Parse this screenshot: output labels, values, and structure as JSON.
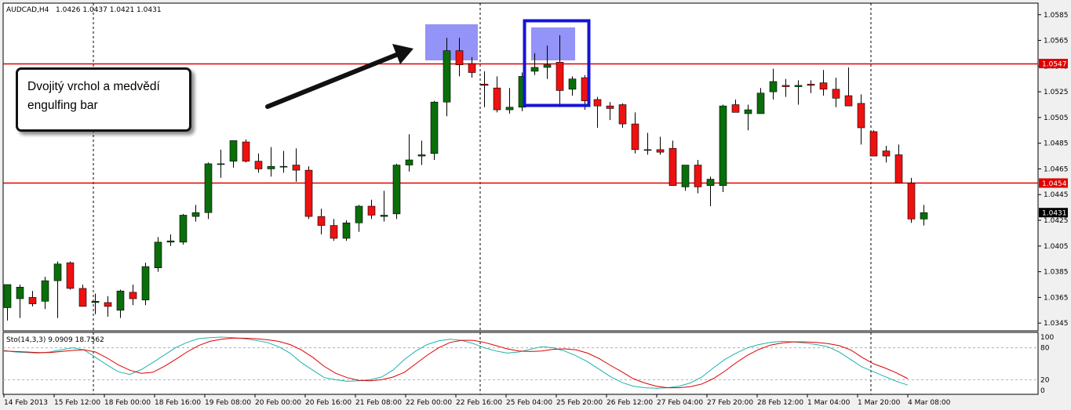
{
  "chart_header": {
    "symbol_timeframe": "AUDCAD,H4",
    "ohlc": "1.0426 1.0437 1.0421 1.0431"
  },
  "annotation": {
    "line1": "Dvojitý vrchol a medvědí",
    "line2": "engulfing bar"
  },
  "indicator": {
    "label": "Sto(14,3,3) 9.0909 18.7562",
    "levels": [
      "100",
      "80",
      "20",
      "0"
    ]
  },
  "colors": {
    "bull_body": "#0a6e0a",
    "bear_body": "#ee1111",
    "wick": "#000000",
    "hline": "#e00000",
    "highlight": "#6f6ff5",
    "box_border": "#1414d8",
    "stoch_main": "#20b2aa",
    "stoch_signal": "#e00000",
    "price_tag_bg": "#e00000",
    "last_price_bg": "#000000"
  },
  "chart_data": {
    "type": "candlestick",
    "y_axis_ticks": [
      "1.0585",
      "1.0565",
      "1.0545",
      "1.0525",
      "1.0505",
      "1.0485",
      "1.0465",
      "1.0445",
      "1.0425",
      "1.0405",
      "1.0385",
      "1.0365",
      "1.0345"
    ],
    "ylim": [
      1.0339,
      1.0594
    ],
    "horizontal_lines": [
      {
        "label": "1.0547",
        "value": 1.0547
      },
      {
        "label": "1.0454",
        "value": 1.0454
      }
    ],
    "last_price": {
      "label": "1.0431",
      "value": 1.0431
    },
    "x_axis_labels": [
      "14 Feb 2013",
      "15 Feb 12:00",
      "18 Feb 00:00",
      "18 Feb 16:00",
      "19 Feb 08:00",
      "20 Feb 00:00",
      "20 Feb 16:00",
      "21 Feb 08:00",
      "22 Feb 00:00",
      "22 Feb 16:00",
      "25 Feb 04:00",
      "25 Feb 20:00",
      "26 Feb 12:00",
      "27 Feb 04:00",
      "27 Feb 20:00",
      "28 Feb 12:00",
      "1 Mar 04:00",
      "1 Mar 20:00",
      "4 Mar 08:00"
    ],
    "candles": [
      [
        1.0357,
        1.0375,
        1.0347,
        1.0375
      ],
      [
        1.0364,
        1.0375,
        1.0349,
        1.0373
      ],
      [
        1.0365,
        1.037,
        1.0358,
        1.036
      ],
      [
        1.0362,
        1.0381,
        1.0356,
        1.0378
      ],
      [
        1.0378,
        1.0393,
        1.0349,
        1.0391
      ],
      [
        1.0392,
        1.0393,
        1.0371,
        1.0372
      ],
      [
        1.0372,
        1.0375,
        1.0358,
        1.0358
      ],
      [
        1.0361,
        1.0368,
        1.0352,
        1.0362
      ],
      [
        1.0361,
        1.0366,
        1.035,
        1.0358
      ],
      [
        1.0355,
        1.0371,
        1.0349,
        1.037
      ],
      [
        1.0369,
        1.0375,
        1.0359,
        1.0364
      ],
      [
        1.0363,
        1.0392,
        1.0359,
        1.0389
      ],
      [
        1.0388,
        1.0412,
        1.0385,
        1.0408
      ],
      [
        1.0408,
        1.0414,
        1.0405,
        1.0409
      ],
      [
        1.0408,
        1.043,
        1.0406,
        1.0429
      ],
      [
        1.0428,
        1.0437,
        1.0424,
        1.0431
      ],
      [
        1.0431,
        1.047,
        1.0426,
        1.0469
      ],
      [
        1.0469,
        1.048,
        1.0458,
        1.0469
      ],
      [
        1.0471,
        1.0487,
        1.0466,
        1.0487
      ],
      [
        1.0486,
        1.0488,
        1.047,
        1.0471
      ],
      [
        1.0471,
        1.0477,
        1.0462,
        1.0465
      ],
      [
        1.0465,
        1.0482,
        1.0459,
        1.0467
      ],
      [
        1.0467,
        1.0479,
        1.0462,
        1.0467
      ],
      [
        1.0468,
        1.0481,
        1.0455,
        1.0464
      ],
      [
        1.0464,
        1.0467,
        1.0426,
        1.0428
      ],
      [
        1.0428,
        1.0434,
        1.0414,
        1.0421
      ],
      [
        1.0421,
        1.0426,
        1.0409,
        1.0411
      ],
      [
        1.0411,
        1.0425,
        1.0409,
        1.0423
      ],
      [
        1.0423,
        1.0437,
        1.0416,
        1.0436
      ],
      [
        1.0436,
        1.0441,
        1.0426,
        1.0429
      ],
      [
        1.0428,
        1.0448,
        1.0424,
        1.0429
      ],
      [
        1.043,
        1.0469,
        1.0426,
        1.0468
      ],
      [
        1.0468,
        1.0492,
        1.0463,
        1.0472
      ],
      [
        1.0475,
        1.0487,
        1.0468,
        1.0476
      ],
      [
        1.0477,
        1.0518,
        1.0472,
        1.0517
      ],
      [
        1.0517,
        1.0567,
        1.0506,
        1.0557
      ],
      [
        1.0557,
        1.0567,
        1.0537,
        1.0546
      ],
      [
        1.0547,
        1.0552,
        1.0536,
        1.054
      ],
      [
        1.0531,
        1.0541,
        1.0513,
        1.053
      ],
      [
        1.0528,
        1.0537,
        1.0509,
        1.0511
      ],
      [
        1.0511,
        1.0528,
        1.0508,
        1.0513
      ],
      [
        1.0513,
        1.054,
        1.051,
        1.0537
      ],
      [
        1.0541,
        1.0555,
        1.0538,
        1.0544
      ],
      [
        1.0544,
        1.0561,
        1.0535,
        1.0546
      ],
      [
        1.0548,
        1.0569,
        1.0513,
        1.0526
      ],
      [
        1.0527,
        1.0537,
        1.0522,
        1.0535
      ],
      [
        1.0536,
        1.0538,
        1.0511,
        1.0518
      ],
      [
        1.0519,
        1.0521,
        1.0497,
        1.0514
      ],
      [
        1.0514,
        1.0517,
        1.0503,
        1.0512
      ],
      [
        1.0515,
        1.0516,
        1.0497,
        1.05
      ],
      [
        1.05,
        1.0509,
        1.0477,
        1.048
      ],
      [
        1.048,
        1.0493,
        1.0476,
        1.048
      ],
      [
        1.048,
        1.049,
        1.0476,
        1.0478
      ],
      [
        1.0481,
        1.0487,
        1.0452,
        1.0452
      ],
      [
        1.0451,
        1.0465,
        1.0448,
        1.0468
      ],
      [
        1.0468,
        1.0472,
        1.0446,
        1.0451
      ],
      [
        1.0452,
        1.0459,
        1.0436,
        1.0457
      ],
      [
        1.0452,
        1.0515,
        1.0447,
        1.0514
      ],
      [
        1.0515,
        1.0519,
        1.0509,
        1.0509
      ],
      [
        1.0508,
        1.0515,
        1.0495,
        1.0511
      ],
      [
        1.0508,
        1.0528,
        1.0508,
        1.0524
      ],
      [
        1.0525,
        1.0543,
        1.0519,
        1.0533
      ],
      [
        1.053,
        1.0535,
        1.0521,
        1.0529
      ],
      [
        1.0529,
        1.0534,
        1.0515,
        1.053
      ],
      [
        1.0531,
        1.0534,
        1.0524,
        1.053
      ],
      [
        1.0532,
        1.0542,
        1.0522,
        1.0527
      ],
      [
        1.0527,
        1.0536,
        1.0513,
        1.052
      ],
      [
        1.0522,
        1.0544,
        1.0514,
        1.0514
      ],
      [
        1.0516,
        1.0523,
        1.0484,
        1.0497
      ],
      [
        1.0494,
        1.0495,
        1.0475,
        1.0475
      ],
      [
        1.0479,
        1.0483,
        1.047,
        1.0475
      ],
      [
        1.0476,
        1.0484,
        1.0456,
        1.0454
      ],
      [
        1.0454,
        1.0458,
        1.0423,
        1.0426
      ],
      [
        1.0426,
        1.0437,
        1.0421,
        1.0431
      ]
    ],
    "stochastic": {
      "ylim": [
        0,
        100
      ],
      "levels": [
        80,
        20
      ],
      "main": [
        75,
        72,
        71,
        70,
        72,
        76,
        80,
        76,
        62,
        48,
        35,
        30,
        39,
        52,
        66,
        80,
        90,
        97,
        99,
        100,
        99,
        97,
        94,
        90,
        82,
        70,
        52,
        38,
        24,
        20,
        17,
        18,
        20,
        25,
        38,
        58,
        74,
        86,
        93,
        96,
        94,
        88,
        80,
        74,
        70,
        72,
        77,
        82,
        80,
        74,
        65,
        54,
        40,
        26,
        15,
        8,
        5,
        4,
        5,
        8,
        14,
        25,
        42,
        58,
        70,
        80,
        86,
        90,
        92,
        91,
        89,
        86,
        82,
        72,
        58,
        44,
        35,
        26,
        17,
        10
      ],
      "signal": [
        74,
        73,
        72,
        71,
        71,
        73,
        75,
        76,
        72,
        61,
        48,
        38,
        32,
        34,
        45,
        58,
        72,
        84,
        92,
        96,
        98,
        98,
        97,
        95,
        92,
        86,
        76,
        62,
        45,
        32,
        24,
        19,
        18,
        20,
        25,
        34,
        50,
        66,
        80,
        90,
        94,
        94,
        90,
        84,
        78,
        74,
        73,
        74,
        77,
        78,
        76,
        70,
        60,
        47,
        35,
        22,
        14,
        8,
        5,
        5,
        7,
        12,
        22,
        36,
        52,
        66,
        77,
        85,
        89,
        91,
        91,
        90,
        88,
        84,
        76,
        62,
        50,
        42,
        33,
        22
      ]
    }
  }
}
